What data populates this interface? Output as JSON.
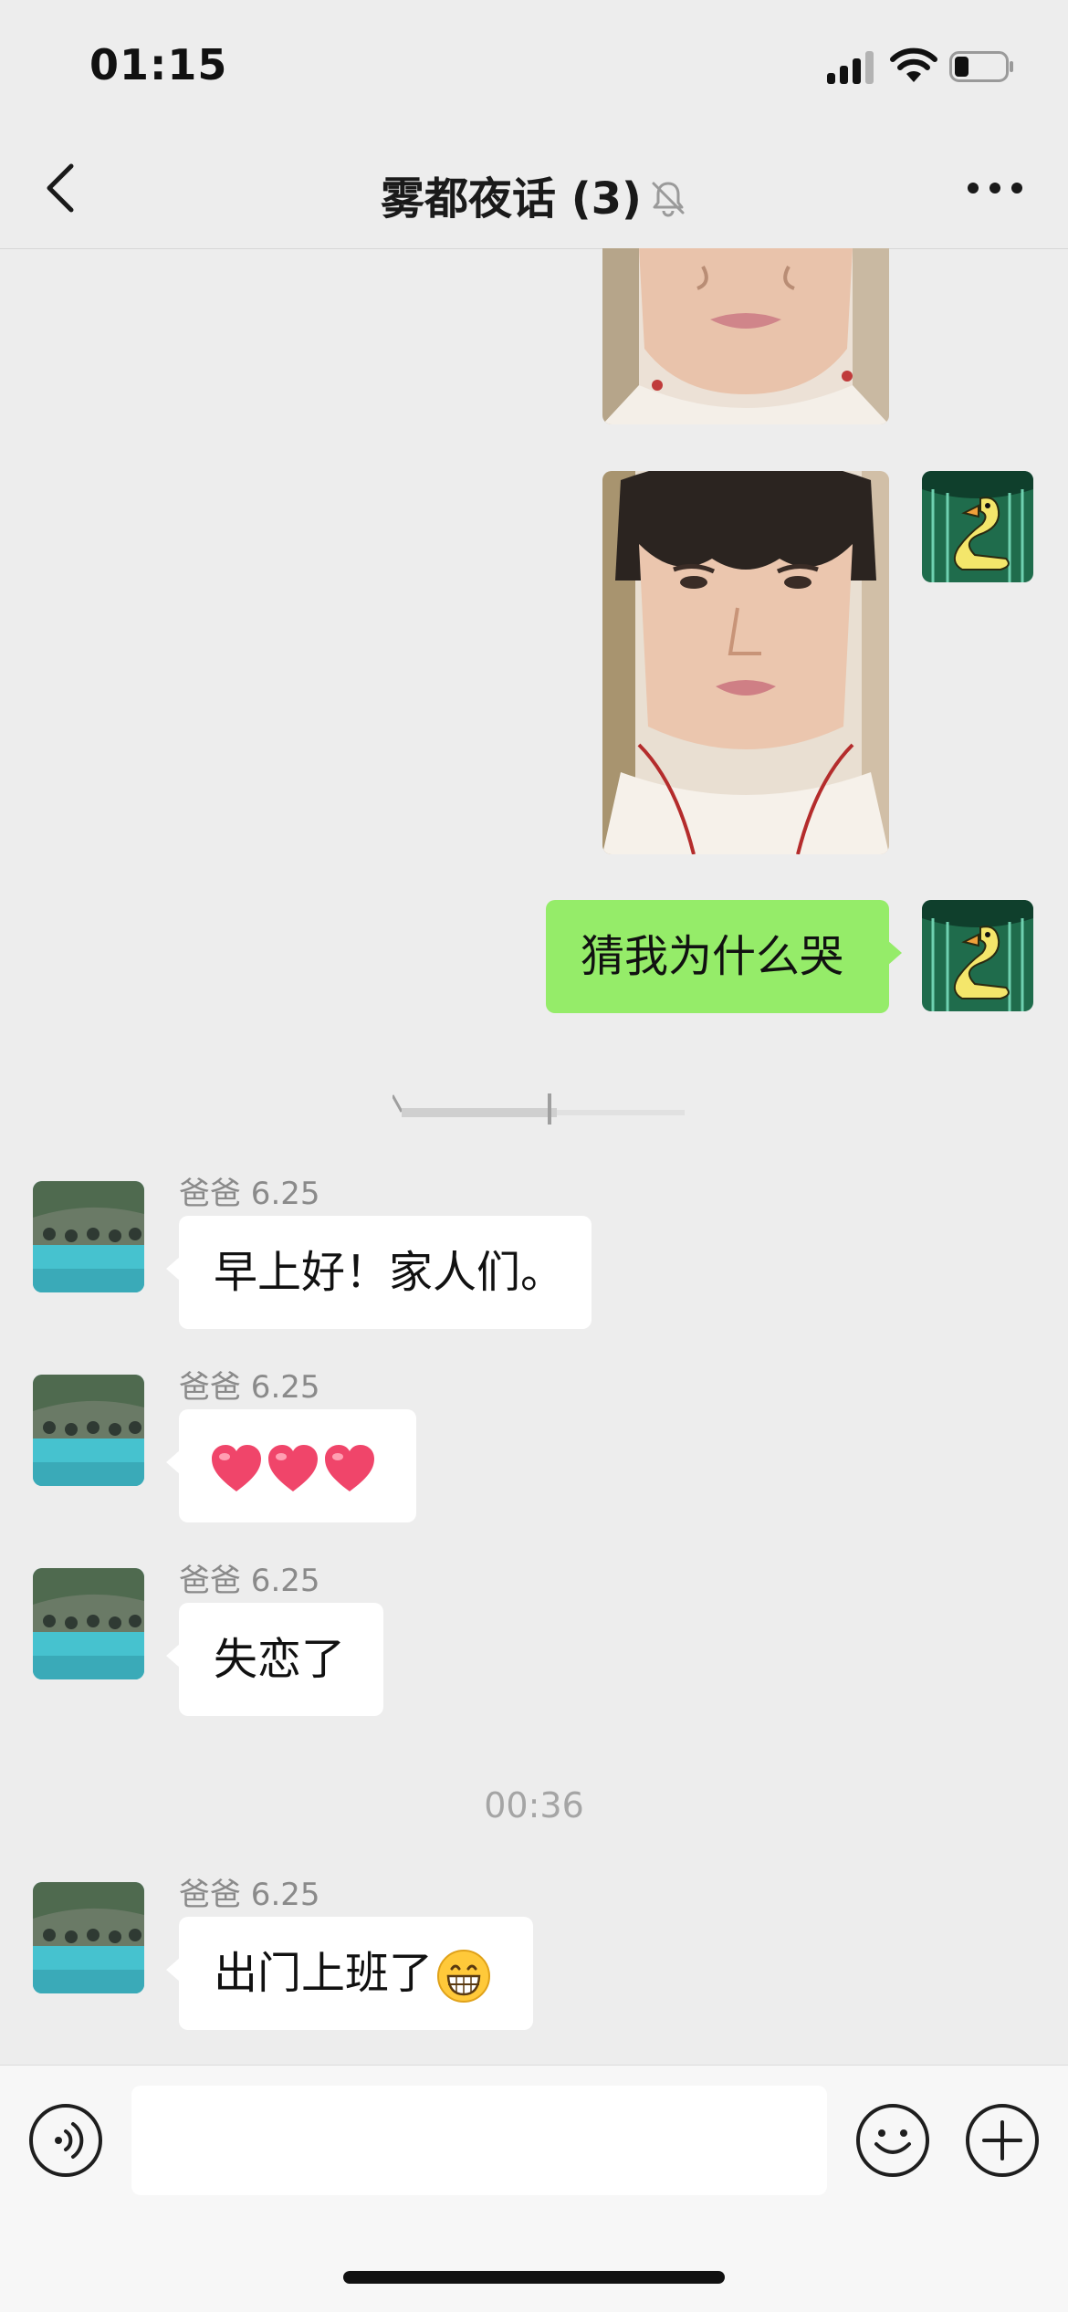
{
  "status_bar": {
    "time": "01:15"
  },
  "nav": {
    "title": "雾都夜话 (3)"
  },
  "messages": {
    "outgoing_text": "猜我为什么哭",
    "incoming": [
      {
        "sender": "爸爸 6.25",
        "text": "早上好！家人们。"
      },
      {
        "sender": "爸爸 6.25",
        "text": ""
      },
      {
        "sender": "爸爸 6.25",
        "text": "失恋了"
      },
      {
        "sender": "爸爸 6.25",
        "text": "出门上班了"
      }
    ],
    "time_divider": "00:36"
  },
  "colors": {
    "background": "#ededed",
    "outgoing_bubble": "#95ec69",
    "incoming_bubble": "#ffffff"
  },
  "icons": {
    "back": "chevron-left-icon",
    "mute": "bell-off-icon",
    "more": "more-dots-icon",
    "voice": "voice-icon",
    "emoji": "emoji-icon",
    "plus": "plus-icon"
  }
}
